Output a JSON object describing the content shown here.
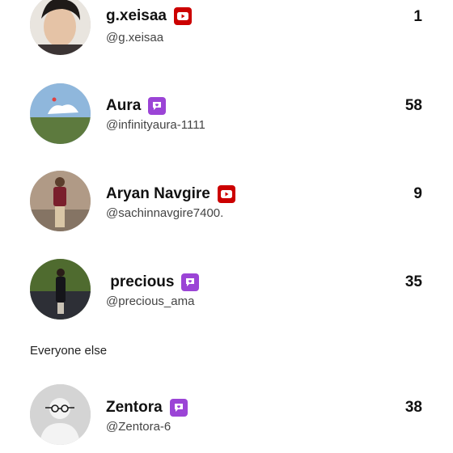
{
  "colors": {
    "youtube_badge": "#cc0000",
    "chat_badge": "#9b44d6",
    "count_text": "#111111"
  },
  "rows": [
    {
      "name": "g.xeisaa",
      "handle": "@g.xeisaa",
      "count": "1",
      "badge": "youtube-icon"
    },
    {
      "name": "Aura",
      "handle": "@infinityaura-1111",
      "count": "58",
      "badge": "chat-bubble-icon"
    },
    {
      "name": "Aryan Navgire",
      "handle": "@sachinnavgire7400.",
      "count": "9",
      "badge": "youtube-icon"
    },
    {
      "name": " precious",
      "handle": "@precious_ama",
      "count": "35",
      "badge": "chat-bubble-icon"
    }
  ],
  "section": {
    "label": "Everyone else"
  },
  "others": [
    {
      "name": "Zentora",
      "handle": "@Zentora-6",
      "count": "38",
      "badge": "chat-bubble-icon"
    }
  ]
}
